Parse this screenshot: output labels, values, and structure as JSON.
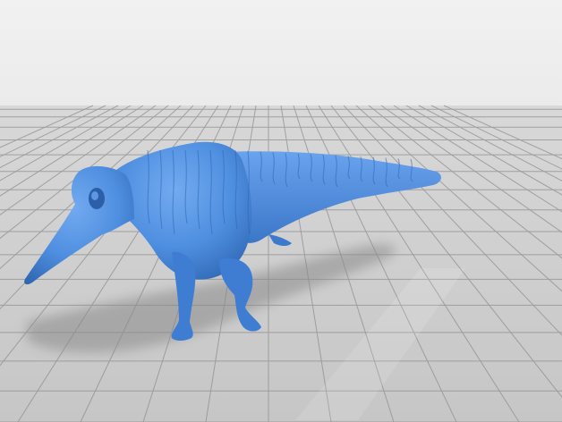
{
  "scene": {
    "subject_icon": "dinosaur-model-icon",
    "colors": {
      "sky_top": "#f1f1f1",
      "sky_bottom": "#d9d9d9",
      "floor": "#c9c9c9",
      "grid_line": "#8e8e8e",
      "model_main": "#4f8fe0",
      "model_light": "#6fa6ee",
      "model_dark": "#2f67b3",
      "shadow": "#8f8f8f"
    }
  }
}
